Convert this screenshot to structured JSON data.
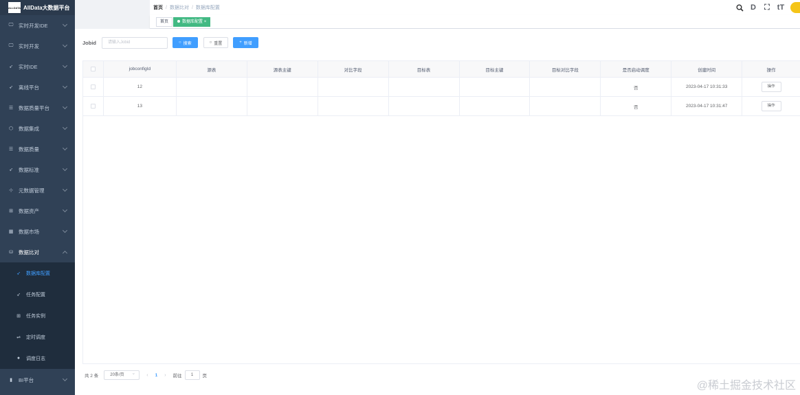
{
  "app": {
    "logo_text": "ALLDATA",
    "title": "AllData大数据平台"
  },
  "sidebar": {
    "items": [
      {
        "label": "实时开发IDE",
        "icon": "monitor-icon",
        "glyph": "🖵"
      },
      {
        "label": "实时开发",
        "icon": "monitor-icon",
        "glyph": "🖵"
      },
      {
        "label": "实时IDE",
        "icon": "send-icon",
        "glyph": "➶"
      },
      {
        "label": "离线平台",
        "icon": "send-icon",
        "glyph": "➶"
      },
      {
        "label": "数据质量平台",
        "icon": "list-icon",
        "glyph": "☰"
      },
      {
        "label": "数据集成",
        "icon": "cube-icon",
        "glyph": "⬡"
      },
      {
        "label": "数据质量",
        "icon": "list-icon",
        "glyph": "☰"
      },
      {
        "label": "数据标准",
        "icon": "send-icon",
        "glyph": "➶"
      },
      {
        "label": "元数据管理",
        "icon": "tree-icon",
        "glyph": "⊹"
      },
      {
        "label": "数据资产",
        "icon": "asset-icon",
        "glyph": "⊞"
      },
      {
        "label": "数据市场",
        "icon": "table-icon",
        "glyph": "▦"
      },
      {
        "label": "数据比对",
        "icon": "database-icon",
        "glyph": "⛁"
      }
    ],
    "sub_items": [
      {
        "label": "数据库配置",
        "icon": "send-icon",
        "glyph": "➶"
      },
      {
        "label": "任务配置",
        "icon": "send-icon",
        "glyph": "➶"
      },
      {
        "label": "任务实例",
        "icon": "grid-icon",
        "glyph": "⊞"
      },
      {
        "label": "定时调度",
        "icon": "schedule-icon",
        "glyph": "⇌"
      },
      {
        "label": "调度日志",
        "icon": "dot-icon",
        "glyph": "●"
      }
    ],
    "bottom": {
      "label": "BI平台",
      "icon": "bar-chart-icon",
      "glyph": "▮"
    }
  },
  "breadcrumb": {
    "home": "首页",
    "level1": "数据比对",
    "level2": "数据库配置",
    "sep": "/"
  },
  "header_icons": {
    "search": "🔍",
    "doc": "D",
    "fullscreen": "⛶",
    "font": "tT"
  },
  "tags": {
    "home": "首页",
    "active": "数据库配置",
    "close": "×"
  },
  "query": {
    "label": "Jobid",
    "placeholder": "请输入Jobid",
    "search_button": "搜索",
    "reset_button": "重置",
    "add_button": "新增",
    "search_glyph": "○",
    "reset_glyph": "○",
    "add_glyph": "+"
  },
  "table": {
    "headers": [
      "jobconfigId",
      "源表",
      "源表主键",
      "对比字段",
      "目标表",
      "目标主键",
      "目标对比字段",
      "是否启动调度",
      "创建时间",
      "操作"
    ],
    "rows": [
      [
        "12",
        "",
        "",
        "",
        "",
        "",
        "",
        "否",
        "2023-04-17 10:31:33",
        "操作"
      ],
      [
        "13",
        "",
        "",
        "",
        "",
        "",
        "",
        "否",
        "2023-04-17 10:31:47",
        "操作"
      ]
    ]
  },
  "pagination": {
    "total": "共 2 条",
    "page_size": "20条/页",
    "prev": "‹",
    "current": "1",
    "next": "›",
    "goto_label": "前往",
    "goto_value": "1",
    "page_unit": "页"
  },
  "watermark": "@稀土掘金技术社区"
}
